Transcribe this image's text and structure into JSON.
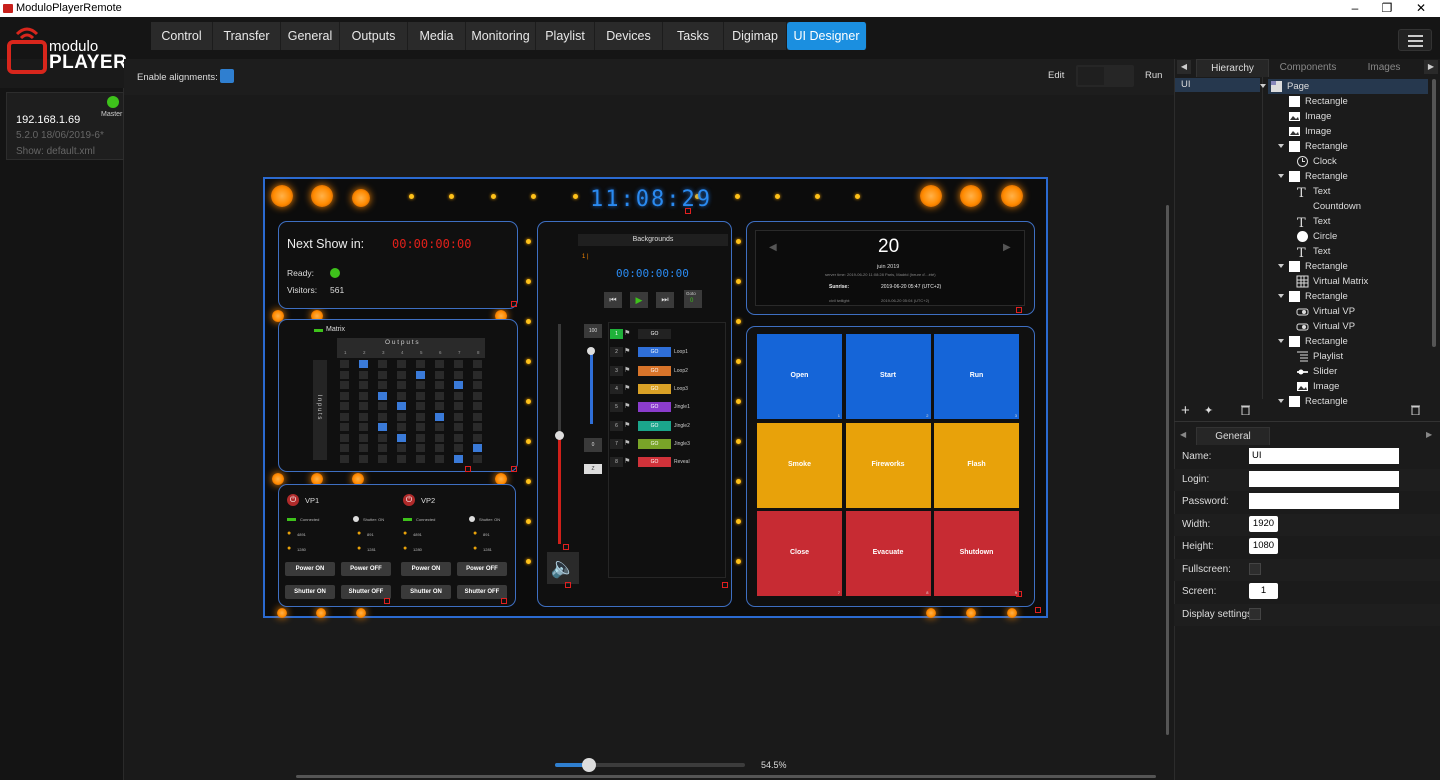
{
  "window": {
    "title": "ModuloPlayerRemote"
  },
  "logo": {
    "line1": "modulo",
    "line2": "PLAYER"
  },
  "tabs": [
    "Control",
    "Transfer",
    "General",
    "Outputs",
    "Media",
    "Monitoring",
    "Playlist",
    "Devices",
    "Tasks",
    "Digimap",
    "UI Designer"
  ],
  "active_tab": "UI Designer",
  "server": {
    "ip": "192.168.1.69",
    "role": "Master",
    "version": "5.2.0 18/06/2019-6*",
    "show": "Show: default.xml",
    "status_color": "#3ec21b"
  },
  "toolbar": {
    "enable_alignments": "Enable alignments:",
    "edit": "Edit",
    "run": "Run"
  },
  "zoom": {
    "label": "54.5%",
    "fraction": 0.545
  },
  "right_panel": {
    "tabs": [
      "Hierarchy",
      "Components",
      "Images"
    ],
    "active_tab": "Hierarchy",
    "list_item": "UI",
    "tree": [
      {
        "label": "Page",
        "icon": "page-icon",
        "level": 0,
        "expand": true,
        "selected": true
      },
      {
        "label": "Rectangle",
        "icon": "rectangle-icon",
        "level": 1,
        "expand": false
      },
      {
        "label": "Image",
        "icon": "image-icon",
        "level": 1,
        "expand": false
      },
      {
        "label": "Image",
        "icon": "image-icon",
        "level": 1,
        "expand": false
      },
      {
        "label": "Rectangle",
        "icon": "rectangle-icon",
        "level": 1,
        "expand": true
      },
      {
        "label": "Clock",
        "icon": "clock-icon",
        "level": 2,
        "expand": false
      },
      {
        "label": "Rectangle",
        "icon": "rectangle-icon",
        "level": 1,
        "expand": true
      },
      {
        "label": "Text",
        "icon": "text-icon",
        "level": 2,
        "expand": false
      },
      {
        "label": "Countdown",
        "icon": "none",
        "level": 2,
        "expand": false
      },
      {
        "label": "Text",
        "icon": "text-icon",
        "level": 2,
        "expand": false
      },
      {
        "label": "Circle",
        "icon": "circle-icon",
        "level": 2,
        "expand": false
      },
      {
        "label": "Text",
        "icon": "text-icon",
        "level": 2,
        "expand": false
      },
      {
        "label": "Rectangle",
        "icon": "rectangle-icon",
        "level": 1,
        "expand": true
      },
      {
        "label": "Virtual Matrix",
        "icon": "matrix-icon",
        "level": 2,
        "expand": false
      },
      {
        "label": "Rectangle",
        "icon": "rectangle-icon",
        "level": 1,
        "expand": true
      },
      {
        "label": "Virtual VP",
        "icon": "projector-icon",
        "level": 2,
        "expand": false
      },
      {
        "label": "Virtual VP",
        "icon": "projector-icon",
        "level": 2,
        "expand": false
      },
      {
        "label": "Rectangle",
        "icon": "rectangle-icon",
        "level": 1,
        "expand": true
      },
      {
        "label": "Playlist",
        "icon": "playlist-icon",
        "level": 2,
        "expand": false
      },
      {
        "label": "Slider",
        "icon": "slider-icon",
        "level": 2,
        "expand": false
      },
      {
        "label": "Image",
        "icon": "image-icon",
        "level": 2,
        "expand": false
      },
      {
        "label": "Rectangle",
        "icon": "rectangle-icon",
        "level": 1,
        "expand": true
      }
    ],
    "props_tab": "General",
    "props": [
      {
        "label": "Name:",
        "value": "UI",
        "type": "text",
        "wide": true
      },
      {
        "label": "Login:",
        "value": "",
        "type": "text",
        "wide": true
      },
      {
        "label": "Password:",
        "value": "",
        "type": "text",
        "wide": true
      },
      {
        "label": "Width:",
        "value": "1920",
        "type": "num"
      },
      {
        "label": "Height:",
        "value": "1080",
        "type": "num"
      },
      {
        "label": "Fullscreen:",
        "value": "",
        "type": "check"
      },
      {
        "label": "Screen:",
        "value": "1",
        "type": "num"
      },
      {
        "label": "Display settings:",
        "value": "",
        "type": "check"
      }
    ]
  },
  "design": {
    "clock": "11:08:29",
    "next_show": {
      "label": "Next Show in:",
      "countdown": "00:00:00:00",
      "ready": "Ready:",
      "visitors_label": "Visitors:",
      "visitors": "561"
    },
    "matrix": {
      "title": "Matrix",
      "outputs": "O u t p u t s",
      "inputs": "I n p u t s",
      "cols": [
        "1",
        "2",
        "3",
        "4",
        "5",
        "6",
        "7",
        "8"
      ],
      "on": [
        [
          0,
          1
        ],
        [
          1,
          4
        ],
        [
          2,
          6
        ],
        [
          3,
          2
        ],
        [
          4,
          3
        ],
        [
          5,
          5
        ],
        [
          6,
          2
        ],
        [
          7,
          3
        ],
        [
          8,
          7
        ],
        [
          9,
          6
        ]
      ]
    },
    "vp": [
      {
        "name": "VP1",
        "connected": "Connected",
        "shutter": "Shutter: ON",
        "v1": "4891",
        "v2": "891",
        "v3": "1280",
        "v4": "1281"
      },
      {
        "name": "VP2",
        "connected": "Connected",
        "shutter": "Shutter: ON",
        "v1": "4891",
        "v2": "891",
        "v3": "1280",
        "v4": "1281"
      }
    ],
    "vp_buttons": [
      "Power ON",
      "Power OFF",
      "Shutter ON",
      "Shutter OFF"
    ],
    "playlist": {
      "title": "Backgrounds",
      "track_label": "1 |",
      "timecode": "00:00:00:00",
      "goto": "Goto",
      "goto_num": "0",
      "vol_top": "100",
      "vol_low": "0",
      "vol_z": "Z",
      "tracks": [
        {
          "num": "1",
          "go": "GO",
          "name": "",
          "color": "#1fb13a",
          "first": true
        },
        {
          "num": "2",
          "go": "GO",
          "name": "Loop1",
          "color": "#2f6fd8"
        },
        {
          "num": "3",
          "go": "GO",
          "name": "Loop2",
          "color": "#d8742a"
        },
        {
          "num": "4",
          "go": "GO",
          "name": "Loop3",
          "color": "#d9a126"
        },
        {
          "num": "5",
          "go": "GO",
          "name": "Jingle1",
          "color": "#8b3ccc"
        },
        {
          "num": "6",
          "go": "GO",
          "name": "Jingle2",
          "color": "#1ba58b"
        },
        {
          "num": "7",
          "go": "GO",
          "name": "Jingle3",
          "color": "#79a428"
        },
        {
          "num": "8",
          "go": "GO",
          "name": "Reveal",
          "color": "#d0323a"
        }
      ]
    },
    "calendar": {
      "day": "20",
      "month": "juin 2019",
      "server_time": "server time: 2019-06-20 11:08:28 Paris, Madrid (heure d'...été)",
      "sunrise_label": "Sunrise:",
      "sunrise": "2019-06-20 05:47 (UTC+2)",
      "twilight_label": "civil twilight:",
      "twilight": "2019-06-20 05:04 (UTC+2)"
    },
    "buttons": [
      {
        "label": "Open",
        "color": "#1565d8",
        "num": "1"
      },
      {
        "label": "Start",
        "color": "#1565d8",
        "num": "2"
      },
      {
        "label": "Run",
        "color": "#1565d8",
        "num": "3"
      },
      {
        "label": "Smoke",
        "color": "#e8a20a",
        "num": ""
      },
      {
        "label": "Fireworks",
        "color": "#e8a20a",
        "num": ""
      },
      {
        "label": "Flash",
        "color": "#e8a20a",
        "num": ""
      },
      {
        "label": "Close",
        "color": "#c72b33",
        "num": "7"
      },
      {
        "label": "Evacuate",
        "color": "#c72b33",
        "num": "8"
      },
      {
        "label": "Shutdown",
        "color": "#c72b33",
        "num": "9"
      }
    ]
  },
  "colors": {
    "accent": "#1b8fe0",
    "frame": "#2b6ad0"
  }
}
